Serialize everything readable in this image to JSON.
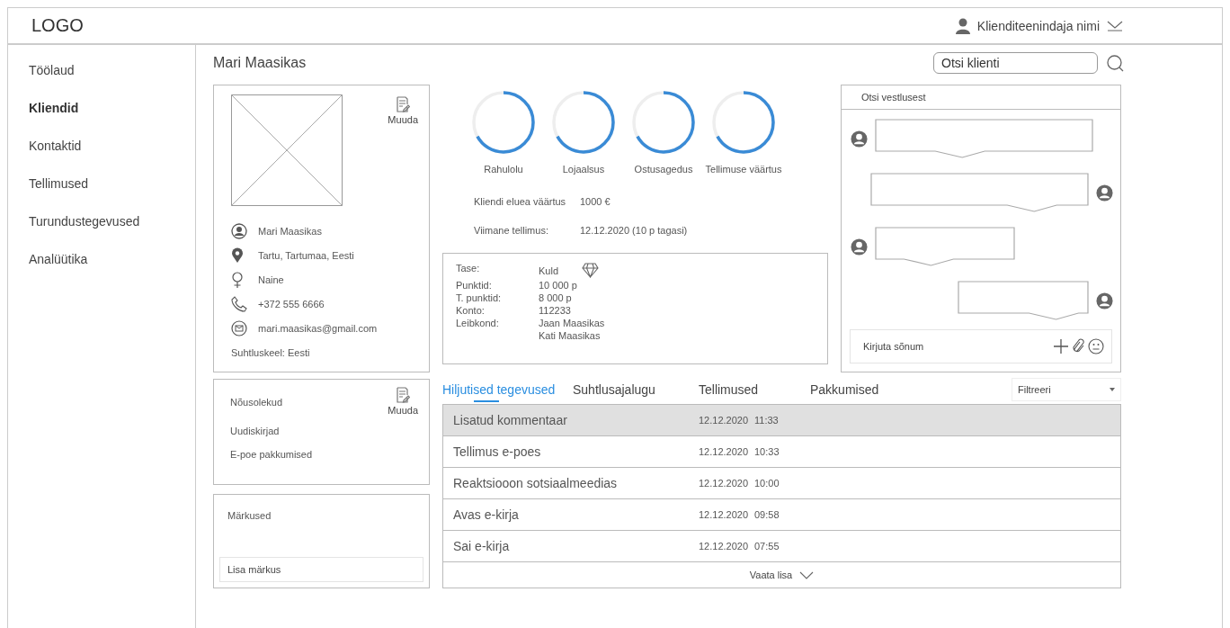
{
  "header": {
    "logo": "LOGO",
    "user": "Klienditeenindaja nimi"
  },
  "sidebar": {
    "items": [
      {
        "label": "Töölaud",
        "selected": false
      },
      {
        "label": "Kliendid",
        "selected": true
      },
      {
        "label": "Kontaktid",
        "selected": false
      },
      {
        "label": "Tellimused",
        "selected": false
      },
      {
        "label": "Turundustegevused",
        "selected": false
      },
      {
        "label": "Analüütika",
        "selected": false
      }
    ]
  },
  "page_title": "Mari Maasikas",
  "search": {
    "placeholder": "Otsi klienti"
  },
  "profile": {
    "edit": "Muuda",
    "details": [
      {
        "kind": "person",
        "text": "Mari Maasikas"
      },
      {
        "kind": "location",
        "text": "Tartu, Tartumaa, Eesti"
      },
      {
        "kind": "gender",
        "text": "Naine"
      },
      {
        "kind": "phone",
        "text": "+372 555 6666"
      },
      {
        "kind": "email",
        "text": "mari.maasikas@gmail.com"
      }
    ],
    "language": "Suhtluskeel: Eesti"
  },
  "meters": [
    {
      "label": "Rahulolu"
    },
    {
      "label": "Lojaalsus"
    },
    {
      "label": "Ostusagedus"
    },
    {
      "label": "Tellimuse väärtus"
    }
  ],
  "stats": [
    {
      "label": "Kliendi eluea väärtus",
      "value": "1000 €"
    },
    {
      "label": "Viimane tellimus:",
      "value": "12.12.2020 (10 p tagasi)"
    }
  ],
  "loyalty": {
    "level_label": "Tase:",
    "level_value": "Kuld",
    "rows": [
      {
        "label": "Punktid:",
        "value": "10 000 p"
      },
      {
        "label": "T. punktid:",
        "value": "8 000 p"
      },
      {
        "label": "Konto:",
        "value": "112233"
      },
      {
        "label": "Leibkond:",
        "value": "Jaan Maasikas"
      },
      {
        "label": "",
        "value": "Kati Maasikas"
      }
    ]
  },
  "chat": {
    "search_placeholder": "Otsi vestlusest",
    "messages": [
      {
        "kind": "incoming"
      },
      {
        "kind": "outgoing"
      },
      {
        "kind": "incoming"
      },
      {
        "kind": "outgoing"
      }
    ],
    "input_placeholder": "Kirjuta sõnum"
  },
  "consents": {
    "title": "Nõusolekud",
    "edit": "Muuda",
    "items": [
      "Uudiskirjad",
      "E-poe pakkumised"
    ]
  },
  "notes": {
    "title": "Märkused",
    "placeholder": "Lisa märkus"
  },
  "tabs": [
    {
      "label": "Hiljutised tegevused",
      "selected": true
    },
    {
      "label": "Suhtlusajalugu",
      "selected": false
    },
    {
      "label": "Tellimused",
      "selected": false
    },
    {
      "label": "Pakkumised",
      "selected": false
    }
  ],
  "filter": {
    "label": "Filtreeri"
  },
  "activities": [
    {
      "name": "Lisatud kommentaar",
      "date": "12.12.2020",
      "time": "11:33",
      "selected": true
    },
    {
      "name": "Tellimus e-poes",
      "date": "12.12.2020",
      "time": "10:33",
      "selected": false
    },
    {
      "name": "Reaktsiooon sotsiaalmeedias",
      "date": "12.12.2020",
      "time": "10:00",
      "selected": false
    },
    {
      "name": "Avas e-kirja",
      "date": "12.12.2020",
      "time": "09:58",
      "selected": false
    },
    {
      "name": "Sai e-kirja",
      "date": "12.12.2020",
      "time": "07:55",
      "selected": false
    }
  ],
  "more": "Vaata lisa"
}
